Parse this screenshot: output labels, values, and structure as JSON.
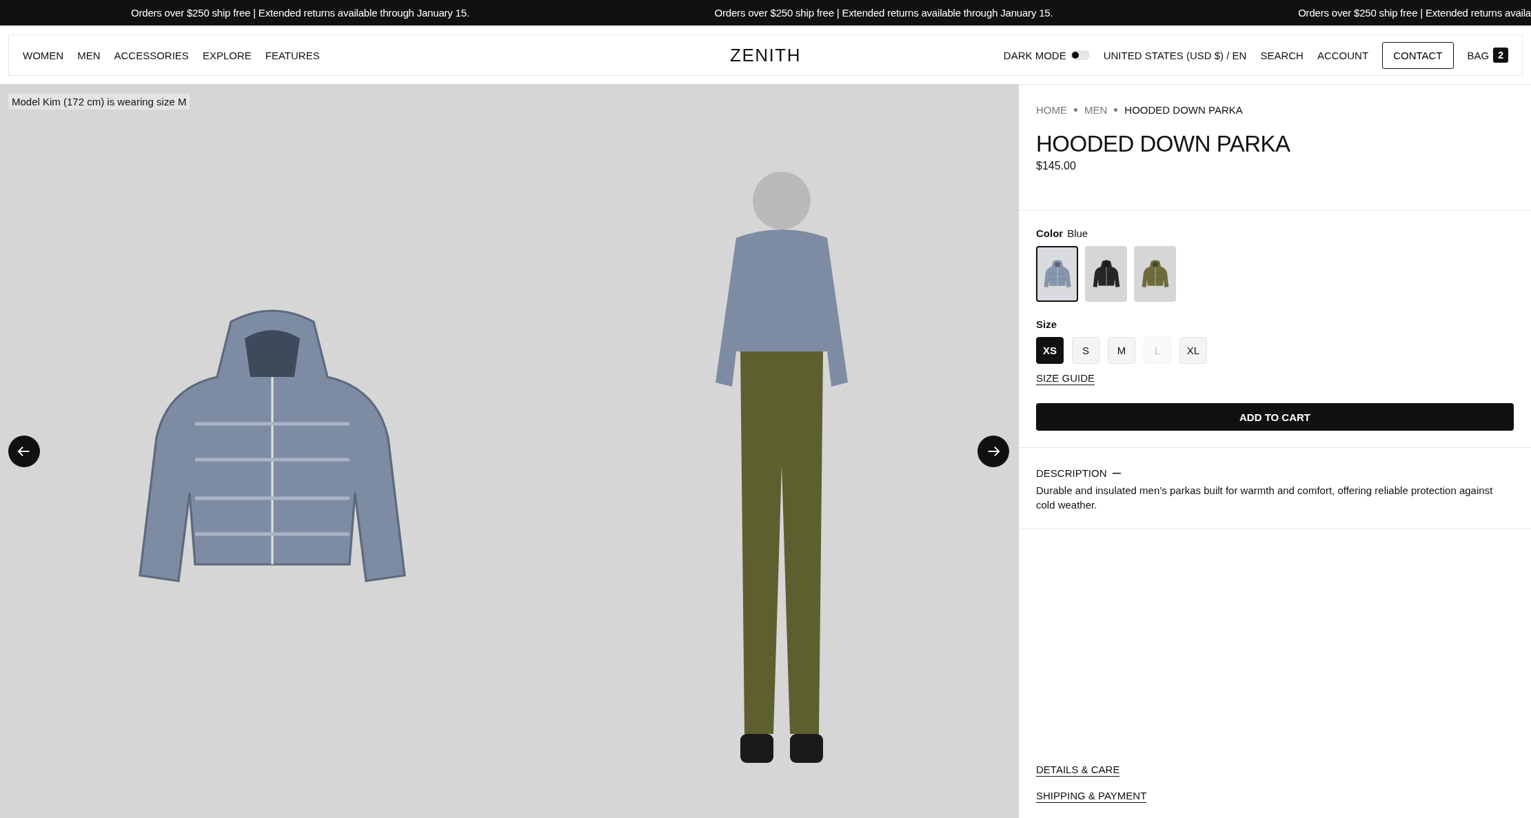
{
  "announcements": [
    "Orders over $250 ship free | Extended returns available through January 15.",
    "Orders over $250 ship free | Extended returns available through January 15.",
    "Orders over $250 ship free | Extended returns availa"
  ],
  "nav": {
    "links": [
      "WOMEN",
      "MEN",
      "ACCESSORIES",
      "EXPLORE",
      "FEATURES"
    ],
    "logo": "ZENITH",
    "dark_mode": {
      "label": "DARK MODE",
      "on": false
    },
    "locale": "UNITED STATES (USD $) / EN",
    "search": "SEARCH",
    "account": "ACCOUNT",
    "contact": "CONTACT",
    "bag": {
      "label": "BAG",
      "count": "2"
    }
  },
  "gallery": {
    "caption": "Model Kim (172 cm) is wearing size M"
  },
  "breadcrumbs": [
    {
      "label": "HOME",
      "current": false
    },
    {
      "label": "MEN",
      "current": false
    },
    {
      "label": "HOODED DOWN PARKA",
      "current": true
    }
  ],
  "product": {
    "title": "HOODED DOWN PARKA",
    "price": "$145.00"
  },
  "color": {
    "label": "Color",
    "value": "Blue",
    "swatches": [
      {
        "selected": true,
        "color": "#8696ad"
      },
      {
        "selected": false,
        "color": "#262626"
      },
      {
        "selected": false,
        "color": "#6e6c3c"
      }
    ]
  },
  "size": {
    "label": "Size",
    "options": [
      {
        "label": "XS",
        "selected": true,
        "disabled": false
      },
      {
        "label": "S",
        "selected": false,
        "disabled": false
      },
      {
        "label": "M",
        "selected": false,
        "disabled": false
      },
      {
        "label": "L",
        "selected": false,
        "disabled": true
      },
      {
        "label": "XL",
        "selected": false,
        "disabled": false
      }
    ],
    "guide": "SIZE GUIDE"
  },
  "add_to_cart": "ADD TO CART",
  "description": {
    "title": "DESCRIPTION",
    "expanded": true,
    "text": "Durable and insulated men’s parkas built for warmth and comfort, offering reliable protection against cold weather."
  },
  "links": [
    "DETAILS & CARE",
    "SHIPPING & PAYMENT"
  ]
}
